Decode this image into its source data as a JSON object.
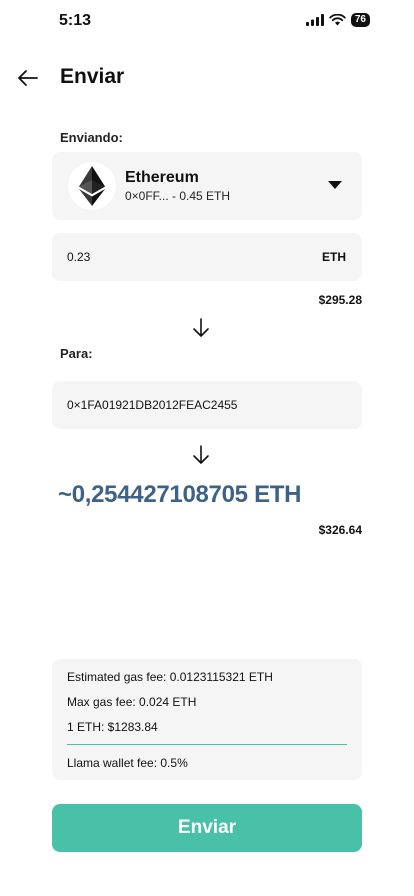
{
  "status_bar": {
    "time": "5:13",
    "battery": "76"
  },
  "header": {
    "title": "Enviar"
  },
  "sending": {
    "label": "Enviando:",
    "token_name": "Ethereum",
    "token_subtitle": "0×0FF... - 0.45 ETH",
    "amount_value": "0.23",
    "amount_unit": "ETH",
    "usd_value": "$295.28"
  },
  "recipient": {
    "label": "Para:",
    "address": "0×1FA01921DB2012FEAC2455"
  },
  "receive": {
    "amount": "~0,254427108705 ETH",
    "usd_value": "$326.64"
  },
  "fees": {
    "estimated_gas": "Estimated gas fee: 0.0123115321 ETH",
    "max_gas": "Max gas fee: 0.024 ETH",
    "eth_price": "1 ETH: $1283.84",
    "wallet_fee": "Llama wallet fee: 0.5%"
  },
  "actions": {
    "submit_label": "Enviar"
  },
  "colors": {
    "accent": "#49c0a8",
    "amount_text": "#3e6186",
    "card_bg": "#f5f5f5"
  }
}
